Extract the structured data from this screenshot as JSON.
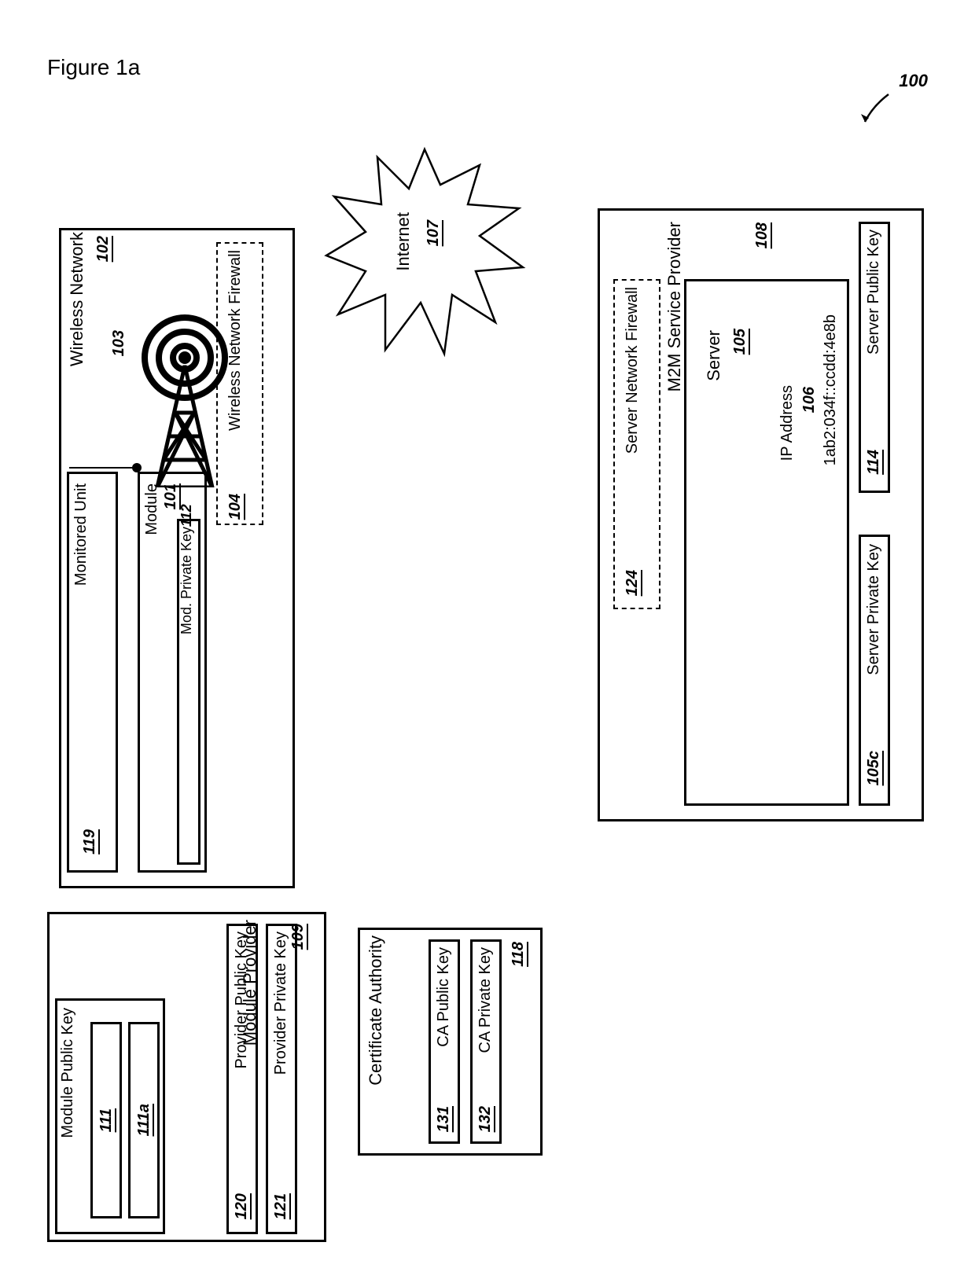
{
  "figure": {
    "title": "Figure 1a",
    "system_ref": "100"
  },
  "wireless_network": {
    "label": "Wireless Network",
    "ref": "102",
    "base_station_ref": "103",
    "firewall": {
      "label": "Wireless Network Firewall",
      "ref": "104"
    },
    "monitored_unit": {
      "label": "Monitored Unit",
      "ref": "119"
    },
    "module": {
      "label": "Module",
      "ref": "101",
      "private_key": {
        "label": "Mod. Private Key ",
        "ref": "112"
      }
    }
  },
  "internet": {
    "label": "Internet",
    "ref": "107"
  },
  "module_provider": {
    "label": "Module Provider",
    "ref": "109",
    "module_public_key": {
      "label": "Module Public Key",
      "ref_a": "111",
      "ref_b": "111a"
    },
    "provider_public_key": {
      "label": "Provider Public Key",
      "ref": "120"
    },
    "provider_private_key": {
      "label": "Provider Private Key",
      "ref": "121"
    }
  },
  "certificate_authority": {
    "label": "Certificate Authority",
    "ref": "118",
    "public_key": {
      "label": "CA Public Key",
      "ref": "131"
    },
    "private_key": {
      "label": "CA Private Key",
      "ref": "132"
    }
  },
  "m2m": {
    "label": "M2M Service Provider",
    "ref": "108",
    "firewall": {
      "label": "Server Network Firewall",
      "ref": "124"
    },
    "server": {
      "label": "Server",
      "ref": "105",
      "ip": {
        "label": "IP Address",
        "ref": "106",
        "value": "1ab2:034f::ccdd:4e8b"
      }
    },
    "server_public_key": {
      "label": "Server Public Key",
      "ref": "114"
    },
    "server_private_key": {
      "label": "Server Private Key",
      "ref": "105c"
    }
  }
}
